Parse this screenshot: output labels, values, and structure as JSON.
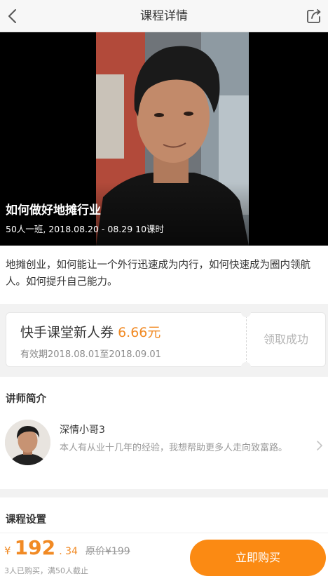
{
  "header": {
    "title": "课程详情",
    "back_icon": "chevron-left-icon",
    "share_icon": "share-icon"
  },
  "course": {
    "title": "如何做好地摊行业",
    "meta": "50人一班, 2018.08.20 - 08.29 10课时",
    "description": "地摊创业，如何能让一个外行迅速成为内行，如何快速成为圈内领航人。如何提升自己能力。"
  },
  "coupon": {
    "name": "快手课堂新人券",
    "amount": "6.66元",
    "validity": "有效期2018.08.01至2018.09.01",
    "status": "领取成功"
  },
  "teacher": {
    "section_title": "讲师简介",
    "name": "深情小哥3",
    "bio": "本人有从业十几年的经验，我想帮助更多人走向致富路。"
  },
  "settings": {
    "section_title": "课程设置"
  },
  "purchase": {
    "currency_symbol": "¥",
    "price_integer": "192",
    "price_decimal": ". 34",
    "original_price": "原价¥199",
    "sales_note": "3人已购买，满50人截止",
    "buy_label": "立即购买"
  },
  "colors": {
    "accent": "#f18a24",
    "button": "#fb8a13",
    "background": "#f2f2f2"
  }
}
